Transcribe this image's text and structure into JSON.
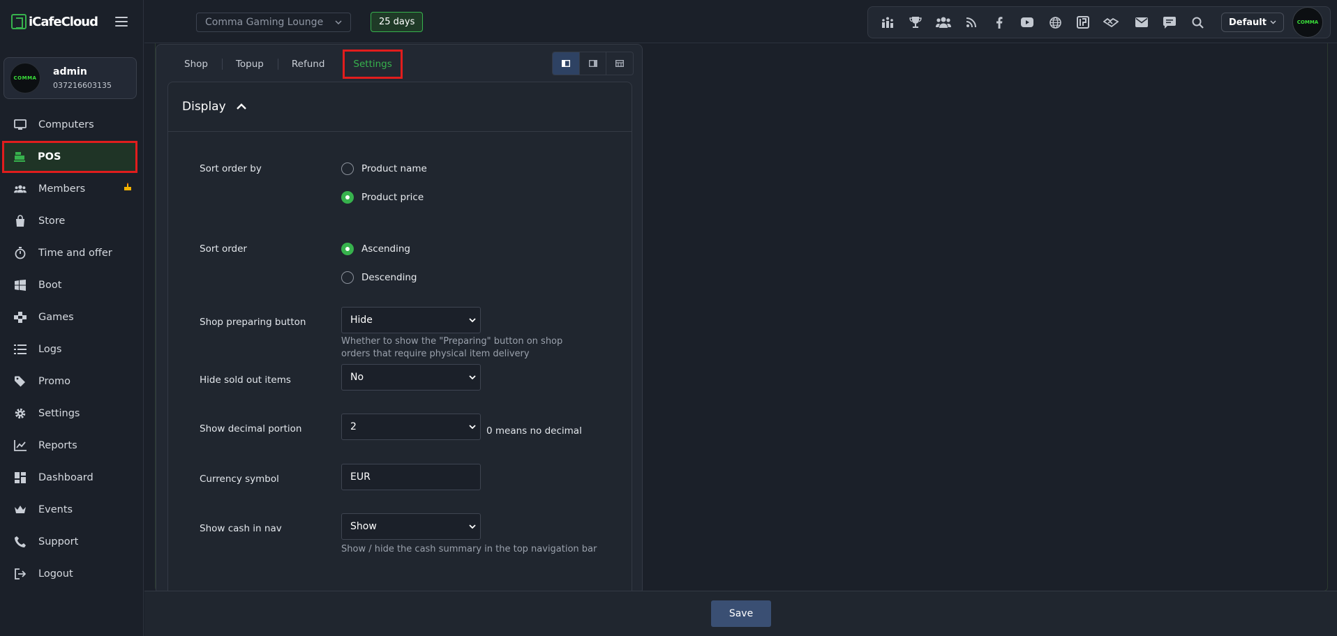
{
  "app": {
    "logo_text": "iCafeCloud"
  },
  "user": {
    "name": "admin",
    "phone": "037216603135",
    "avatar_text": "COMMA"
  },
  "sidebar": {
    "items": [
      {
        "label": "Computers",
        "icon": "monitor-icon"
      },
      {
        "label": "POS",
        "icon": "cash-register-icon",
        "active": true
      },
      {
        "label": "Members",
        "icon": "users-icon",
        "badge": "birthday-cake-icon"
      },
      {
        "label": "Store",
        "icon": "shopping-bag-icon"
      },
      {
        "label": "Time and offer",
        "icon": "stopwatch-icon"
      },
      {
        "label": "Boot",
        "icon": "windows-icon"
      },
      {
        "label": "Games",
        "icon": "gamepad-icon"
      },
      {
        "label": "Logs",
        "icon": "list-icon"
      },
      {
        "label": "Promo",
        "icon": "tag-icon"
      },
      {
        "label": "Settings",
        "icon": "gear-icon"
      },
      {
        "label": "Reports",
        "icon": "chart-line-icon"
      },
      {
        "label": "Dashboard",
        "icon": "dashboard-icon"
      },
      {
        "label": "Events",
        "icon": "crown-icon"
      },
      {
        "label": "Support",
        "icon": "phone-icon"
      },
      {
        "label": "Logout",
        "icon": "logout-icon"
      }
    ]
  },
  "topbar": {
    "branch": "Comma Gaming Lounge",
    "days_left": "25 days",
    "profile": "Default",
    "icons": [
      "leaderboard-icon",
      "trophy-icon",
      "users-group-icon",
      "rss-icon",
      "facebook-icon",
      "youtube-icon",
      "globe-icon",
      "icafe-icon",
      "handshake-icon",
      "mail-icon",
      "chat-icon",
      "search-icon"
    ]
  },
  "pos": {
    "tabs": [
      "Shop",
      "Topup",
      "Refund",
      "Settings"
    ],
    "active_tab": "Settings",
    "section_title": "Display",
    "sort_order_by": {
      "label": "Sort order by",
      "options": [
        "Product name",
        "Product price"
      ],
      "selected": "Product price"
    },
    "sort_order": {
      "label": "Sort order",
      "options": [
        "Ascending",
        "Descending"
      ],
      "selected": "Ascending"
    },
    "preparing_button": {
      "label": "Shop preparing button",
      "value": "Hide",
      "hint": "Whether to show the \"Preparing\" button on shop orders that require physical item delivery"
    },
    "hide_sold_out": {
      "label": "Hide sold out items",
      "value": "No"
    },
    "decimal": {
      "label": "Show decimal portion",
      "value": "2",
      "note": "0 means no decimal"
    },
    "currency": {
      "label": "Currency symbol",
      "value": "EUR"
    },
    "cash_in_nav": {
      "label": "Show cash in nav",
      "value": "Show",
      "hint": "Show / hide the cash summary in the top navigation bar"
    },
    "save_label": "Save"
  },
  "colors": {
    "accent": "#37b24d",
    "highlight": "#e11d1d",
    "save": "#3a4f73"
  }
}
